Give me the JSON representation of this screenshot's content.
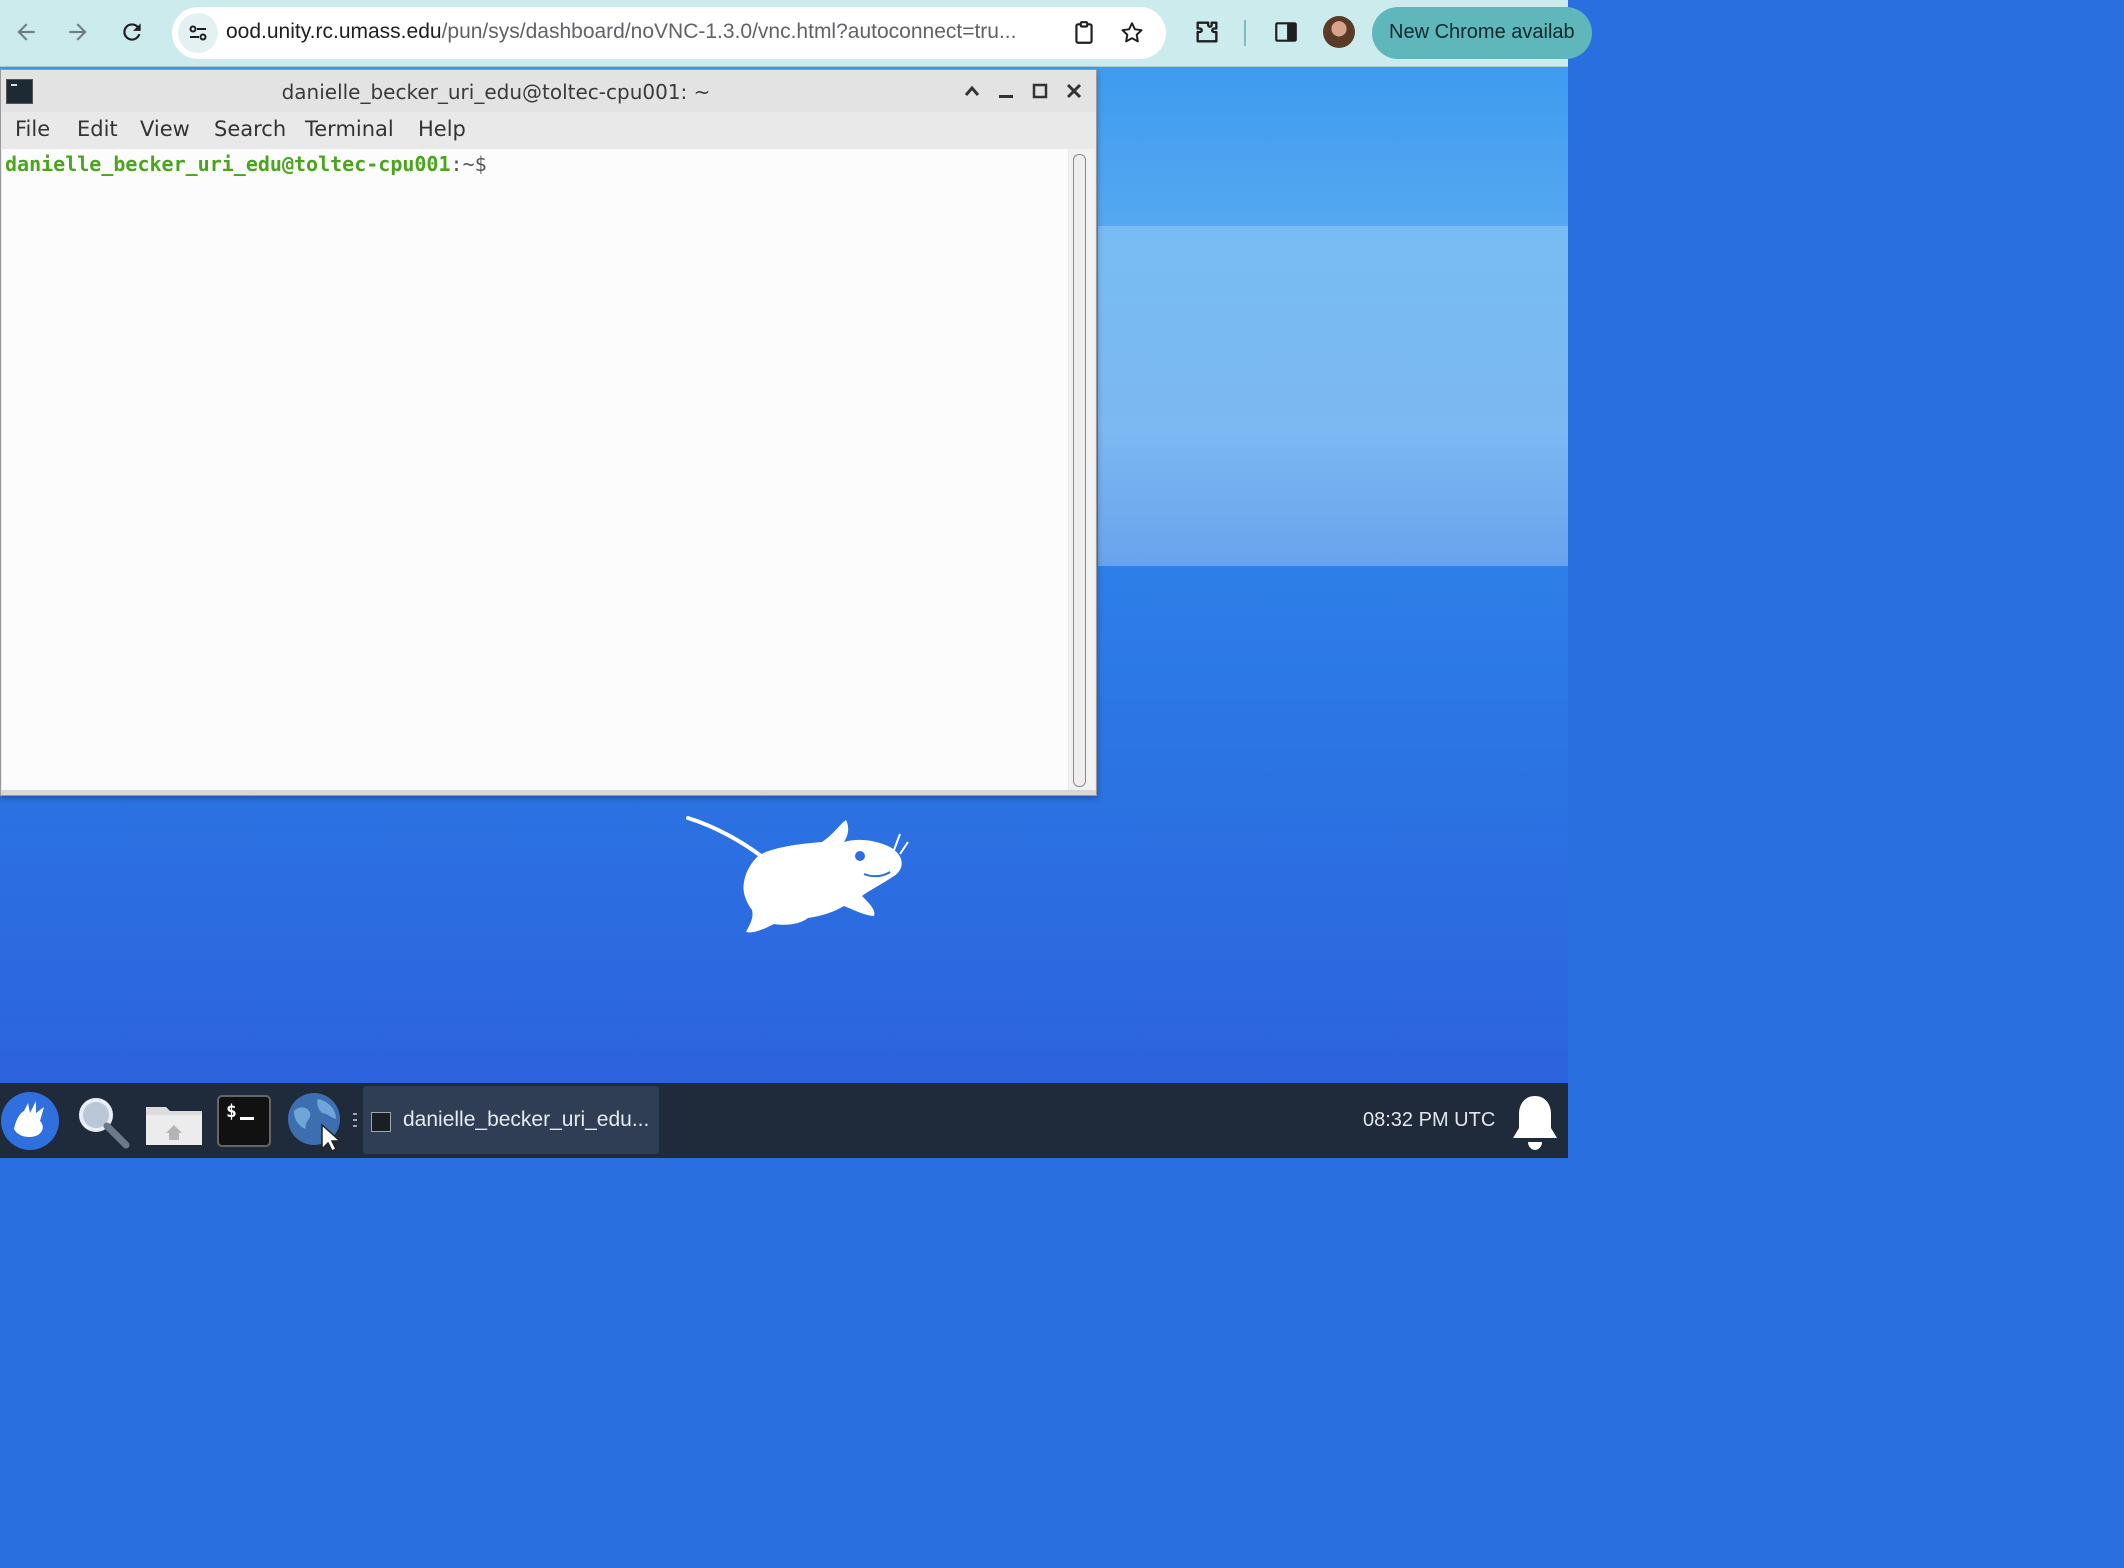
{
  "browser": {
    "url_host": "ood.unity.rc.umass.edu",
    "url_path": "/pun/sys/dashboard/noVNC-1.3.0/vnc.html?autoconnect=tru...",
    "update_label": "New Chrome availab",
    "icons": [
      "back-icon",
      "forward-icon",
      "reload-icon",
      "site-info-icon",
      "clipboard-icon",
      "star-icon",
      "extensions-icon",
      "side-panel-icon",
      "profile-avatar"
    ]
  },
  "terminal": {
    "title": "danielle_becker_uri_edu@toltec-cpu001: ~",
    "menu": [
      "File",
      "Edit",
      "View",
      "Search",
      "Terminal",
      "Help"
    ],
    "prompt_user": "danielle_becker_uri_edu@toltec-cpu001",
    "prompt_rest": ":~$"
  },
  "taskbar": {
    "task_label": "danielle_becker_uri_edu...",
    "clock": "08:32 PM UTC",
    "launchers": [
      "xfce-menu-icon",
      "search-icon",
      "home-folder-icon",
      "terminal-icon",
      "web-browser-icon"
    ]
  },
  "colors": {
    "chrome_toolbar": "#ccebed",
    "prompt_green": "#4aa51c",
    "desktop_blue": "#2a6fe0",
    "taskbar": "#1f2a3a"
  }
}
